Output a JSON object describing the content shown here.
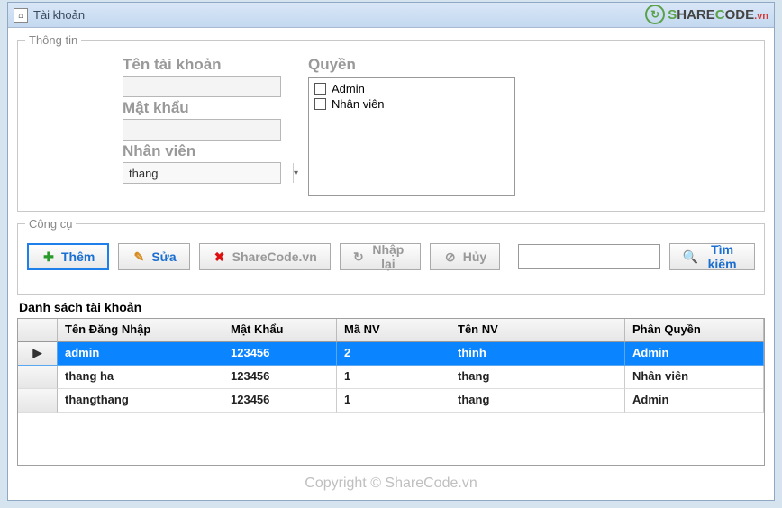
{
  "window": {
    "title": "Tài khoản"
  },
  "brand": {
    "text_dark": "SHARECODE",
    "text_green": "",
    "suffix": ".vn"
  },
  "groupbox": {
    "title": "Thông tin"
  },
  "fields": {
    "username_label": "Tên tài khoản",
    "password_label": "Mật khẩu",
    "employee_label": "Nhân viên",
    "employee_value": "thang",
    "perm_label": "Quyền",
    "perm_options": {
      "admin": "Admin",
      "staff": "Nhân viên"
    }
  },
  "tools": {
    "legend": "Công cụ",
    "add": "Thêm",
    "edit": "Sửa",
    "delete": "ShareCode.vn",
    "reload": "Nhập lại",
    "cancel": "Hủy",
    "search": "Tìm kiếm"
  },
  "list": {
    "title": "Danh sách tài khoản",
    "headers": {
      "c1": "Tên Đăng Nhập",
      "c2": "Mật Khẩu",
      "c3": "Mã NV",
      "c4": "Tên NV",
      "c5": "Phân Quyền"
    },
    "rows": [
      {
        "indicator": "▶",
        "c1": "admin",
        "c2": "123456",
        "c3": "2",
        "c4": "thinh",
        "c5": "Admin",
        "selected": true
      },
      {
        "indicator": "",
        "c1": "thang ha",
        "c2": "123456",
        "c3": "1",
        "c4": "thang",
        "c5": "Nhân viên",
        "selected": false
      },
      {
        "indicator": "",
        "c1": "thangthang",
        "c2": "123456",
        "c3": "1",
        "c4": "thang",
        "c5": "Admin",
        "selected": false
      }
    ]
  },
  "watermark": {
    "center": "",
    "bottom": "Copyright © ShareCode.vn"
  }
}
